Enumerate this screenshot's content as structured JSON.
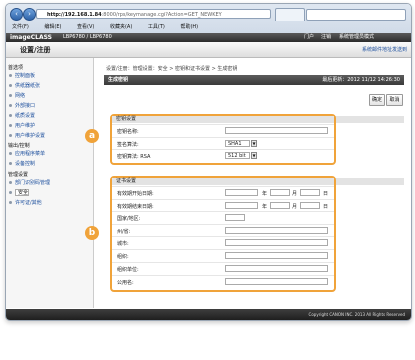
{
  "browser": {
    "url_host": "http://192.168.1.84",
    "url_path": ":8000/rps/keymanage.cgi?Action=GET_NEWKEY",
    "menu": [
      "文件(F)",
      "编辑(E)",
      "查看(V)",
      "收藏夹(A)",
      "工具(T)",
      "帮助(H)"
    ]
  },
  "app": {
    "logo": "imageCLASS",
    "device": "LBP6780 / LBP6780",
    "top_right_1": "门户",
    "top_right_2": "注销",
    "top_right_3": "系统管理员模式",
    "page_title": "设置/注册",
    "link_right": "系统邮件地址发送到"
  },
  "sidebar": {
    "groups": [
      {
        "title": "首选项",
        "items": [
          "控制面板",
          "供纸器纸张",
          "网络",
          "外部接口",
          "纸质设置",
          "用户维护",
          "用户维护设置"
        ]
      },
      {
        "title": "输出/控制",
        "items": [
          "应用程序菜单",
          "设备控制"
        ]
      },
      {
        "title": "管理设置",
        "items": [
          "部门识别码管理",
          "安全",
          "许可证/其他"
        ]
      }
    ],
    "selected": "安全"
  },
  "main": {
    "breadcrumb": "设置/注册：管理设置：安全 > 密钥和证书设置 > 生成密钥",
    "panel_title": "生成密钥",
    "panel_time": "最后更新：2012 11/12 14:26:30",
    "ok": "确定",
    "cancel": "取消",
    "key_section": {
      "title": "密钥设置",
      "rows": [
        {
          "label": "密钥名称:"
        },
        {
          "label": "签名算法:",
          "value": "SHA1"
        },
        {
          "label": "密钥算法: RSA",
          "value": "512 bit"
        }
      ]
    },
    "cert_section": {
      "title": "证书设置",
      "start_label": "有效期开始日期:",
      "end_label": "有效期结束日期:",
      "year": "年",
      "month": "月",
      "day": "日",
      "fields": [
        "国家/地区:",
        "州/省:",
        "城市:",
        "组织:",
        "组织单位:",
        "公用名:"
      ]
    }
  },
  "badges": {
    "a": "a",
    "b": "b"
  },
  "footer": "Copyright CANON INC. 2013 All Rights Reserved"
}
